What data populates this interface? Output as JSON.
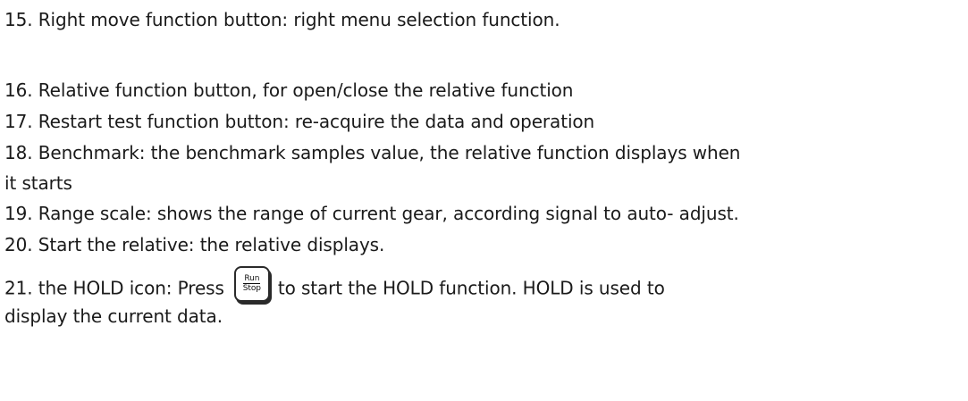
{
  "lines": [
    "15. Right move function button: right menu selection function.",
    "16. Relative function button, for open/close the relative function",
    "17. Restart test function button: re-acquire the data and operation",
    "18. Benchmark: the benchmark samples value, the relative function displays when",
    "it starts",
    "19. Range scale: shows the range of current gear, according signal to auto- adjust.",
    "20. Start the relative: the relative displays."
  ],
  "item21": {
    "before": "21. the HOLD icon: Press",
    "after": "to start the HOLD function. HOLD is used to",
    "continuation": "display the current data.",
    "button": {
      "top_label": "Run",
      "bottom_label": "Stop",
      "icon": "run-stop-key-icon"
    }
  }
}
